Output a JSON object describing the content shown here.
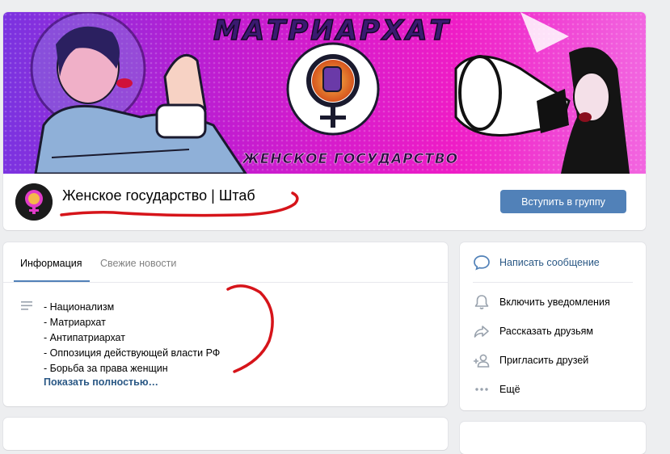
{
  "cover": {
    "headline": "МАТРИАРХАТ",
    "subtitle": "ЖЕНСКОЕ ГОСУДАРСТВО"
  },
  "group": {
    "title": "Женское государство | Штаб",
    "join_label": "Вступить в группу"
  },
  "info": {
    "tabs": [
      {
        "label": "Информация"
      },
      {
        "label": "Свежие новости"
      }
    ],
    "lines": [
      "- Национализм",
      "- Матриархат",
      "- Антипатриархат",
      "- Оппозиция действующей власти РФ",
      "- Борьба за права женщин"
    ],
    "show_more": "Показать полностью…"
  },
  "actions": {
    "message": "Написать сообщение",
    "notifications": "Включить уведомления",
    "share": "Рассказать друзьям",
    "invite": "Пригласить друзей",
    "more": "Ещё"
  },
  "colors": {
    "accent": "#5181b8",
    "link": "#2a5885",
    "cover_pink": "#e81cc8",
    "cover_purple": "#6a2bd8",
    "scribble": "#d6141a"
  }
}
